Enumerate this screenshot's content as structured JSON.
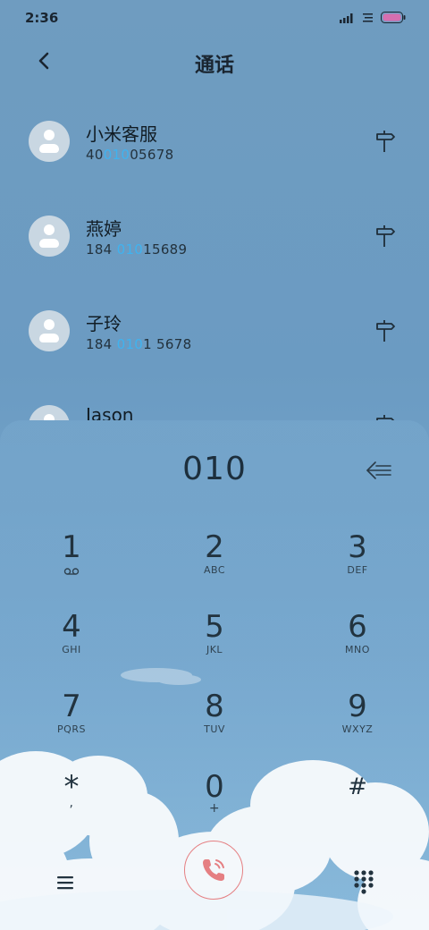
{
  "status": {
    "time": "2:36"
  },
  "header": {
    "title": "通话"
  },
  "contacts": [
    {
      "name": "小米客服",
      "num_pre": "40",
      "num_hl": "010",
      "num_post": "05678"
    },
    {
      "name": "燕婷",
      "num_pre": "184 ",
      "num_hl": "010",
      "num_post": "15689"
    },
    {
      "name": "子玲",
      "num_pre": "184 ",
      "num_hl": "010",
      "num_post": "1 5678"
    },
    {
      "name": "Jason",
      "num_pre": "",
      "num_hl": "",
      "num_post": ""
    }
  ],
  "dialpad": {
    "display": "010",
    "keys": [
      {
        "digit": "1",
        "letters": ""
      },
      {
        "digit": "2",
        "letters": "ABC"
      },
      {
        "digit": "3",
        "letters": "DEF"
      },
      {
        "digit": "4",
        "letters": "GHI"
      },
      {
        "digit": "5",
        "letters": "JKL"
      },
      {
        "digit": "6",
        "letters": "MNO"
      },
      {
        "digit": "7",
        "letters": "PQRS"
      },
      {
        "digit": "8",
        "letters": "TUV"
      },
      {
        "digit": "9",
        "letters": "WXYZ"
      },
      {
        "digit": "*",
        "letters": ","
      },
      {
        "digit": "0",
        "letters": "+"
      },
      {
        "digit": "#",
        "letters": ""
      }
    ]
  },
  "icons": {
    "back": "chevron-left-icon",
    "pin": "signpost-icon",
    "backspace": "backspace-icon",
    "menu": "menu-icon",
    "call": "phone-icon",
    "keypad": "dialpad-icon",
    "voicemail": "voicemail-icon"
  },
  "colors": {
    "highlight": "#3fb3f0",
    "call_accent": "#e57f82"
  }
}
